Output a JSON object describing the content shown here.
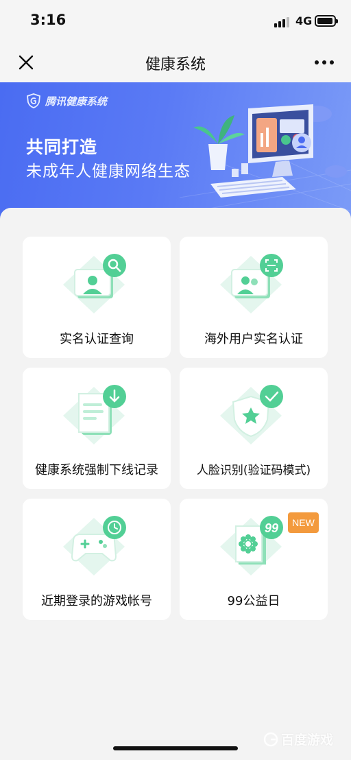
{
  "status_bar": {
    "time": "3:16",
    "network": "4G"
  },
  "nav": {
    "title": "健康系统",
    "close_icon": "close-icon",
    "more_icon": "more-icon"
  },
  "banner": {
    "logo_text": "腾讯健康系统",
    "headline": "共同打造",
    "subheadline": "未成年人健康网络生态"
  },
  "cards": [
    {
      "label": "实名认证查询",
      "icon": "id-search-icon"
    },
    {
      "label": "海外用户实名认证",
      "icon": "id-scan-icon"
    },
    {
      "label": "健康系统强制下线记录",
      "icon": "download-record-icon"
    },
    {
      "label": "人脸识别(验证码模式)",
      "icon": "shield-check-icon"
    },
    {
      "label": "近期登录的游戏帐号",
      "icon": "gamepad-clock-icon"
    },
    {
      "label": "99公益日",
      "icon": "charity-99-icon",
      "badge": "NEW"
    }
  ],
  "watermark": "百度游戏",
  "colors": {
    "banner": "#4a6cf2",
    "accent_green": "#3fc98a",
    "badge": "#f39a3d"
  }
}
